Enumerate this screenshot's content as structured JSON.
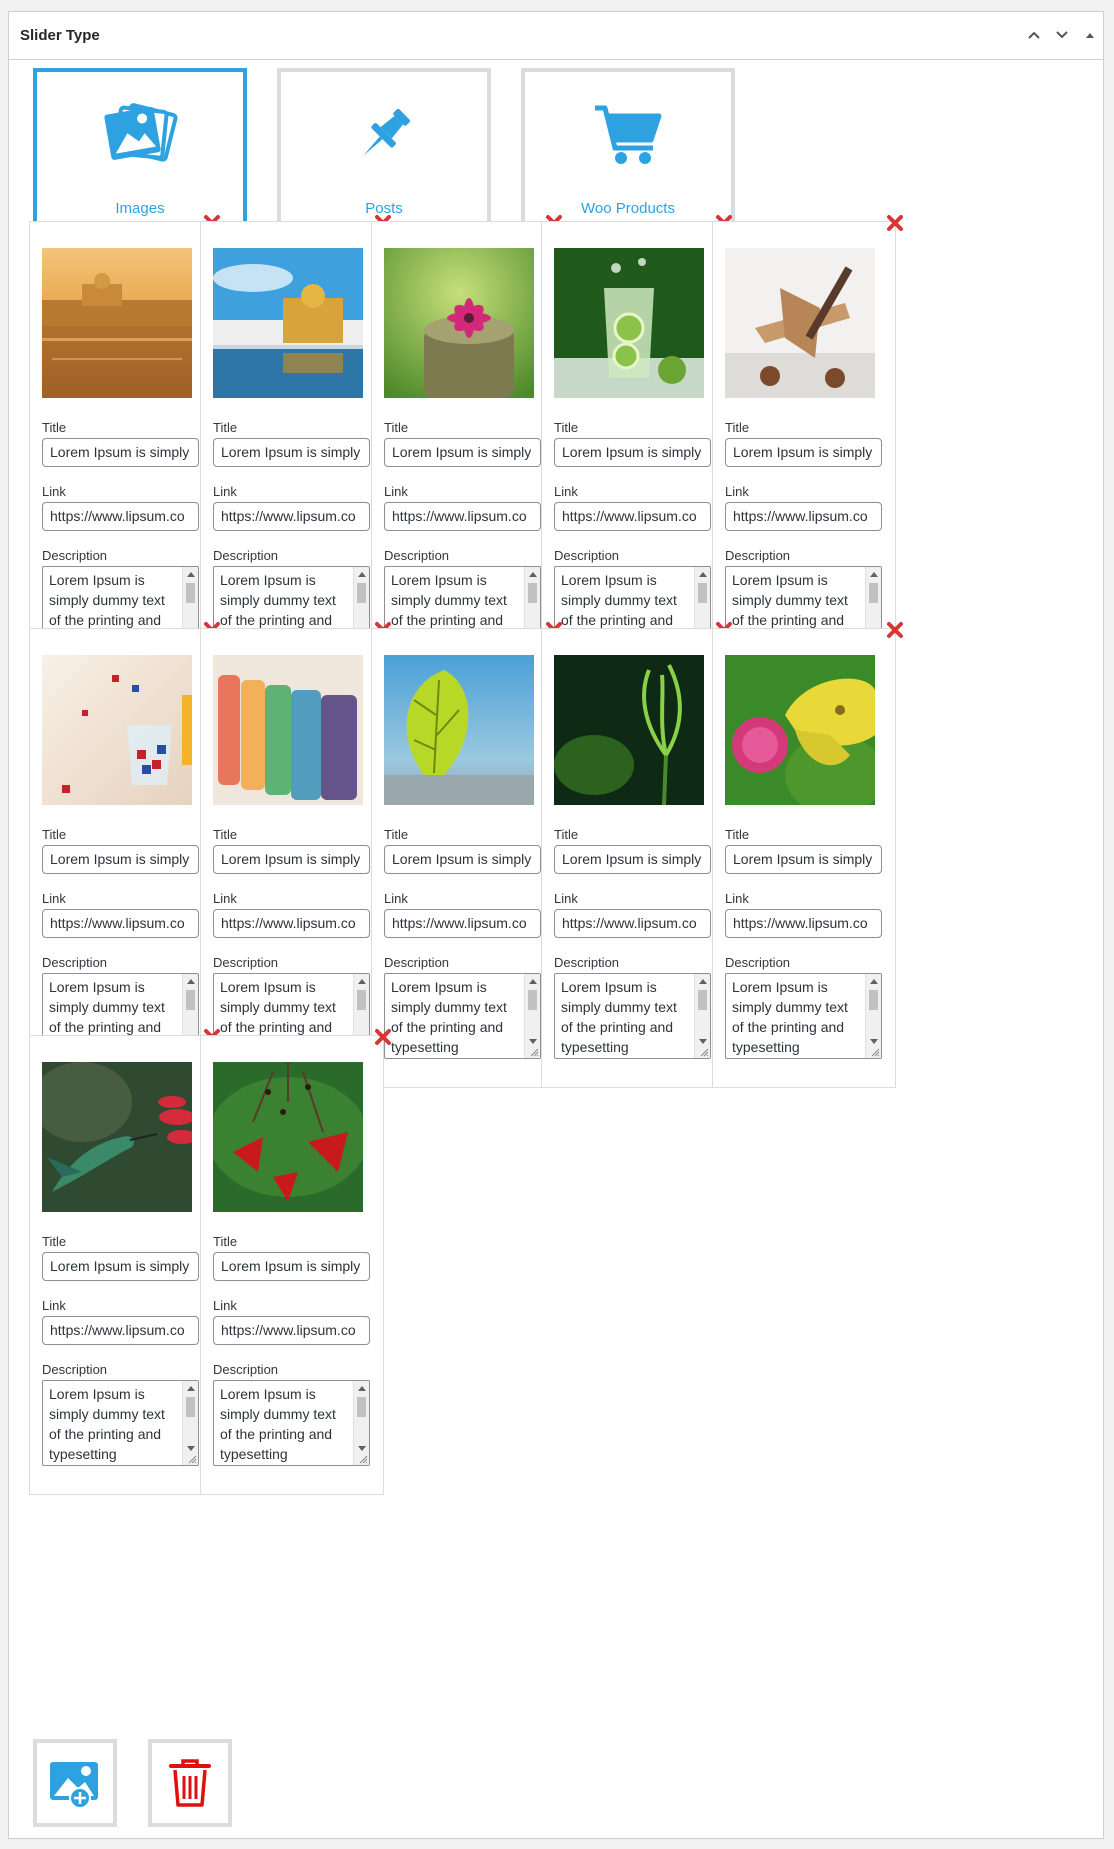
{
  "panel": {
    "title": "Slider Type",
    "header_buttons": [
      "chevron-up-icon",
      "chevron-down-icon",
      "triangle-up-icon"
    ]
  },
  "slider_types": [
    {
      "label": "Images",
      "icon": "images-icon",
      "active": true
    },
    {
      "label": "Posts",
      "icon": "pushpin-icon",
      "active": false
    },
    {
      "label": "Woo Products",
      "icon": "shopping-cart-icon",
      "active": false
    }
  ],
  "field_labels": {
    "title": "Title",
    "link": "Link",
    "description": "Description"
  },
  "slides": [
    {
      "image": "golden-temple-sunset",
      "title": "Lorem Ipsum is simply",
      "link": "https://www.lipsum.co",
      "description": "Lorem Ipsum is simply dummy text of the printing and typesetting"
    },
    {
      "image": "golden-temple-day",
      "title": "Lorem Ipsum is simply",
      "link": "https://www.lipsum.co",
      "description": "Lorem Ipsum is simply dummy text of the printing and typesetting"
    },
    {
      "image": "pink-flower-stump",
      "title": "Lorem Ipsum is simply",
      "link": "https://www.lipsum.co",
      "description": "Lorem Ipsum is simply dummy text of the printing and typesetting"
    },
    {
      "image": "lime-drink-splash",
      "title": "Lorem Ipsum is simply",
      "link": "https://www.lipsum.co",
      "description": "Lorem Ipsum is simply dummy text of the printing and typesetting"
    },
    {
      "image": "wooden-toy-plane",
      "title": "Lorem Ipsum is simply",
      "link": "https://www.lipsum.co",
      "description": "Lorem Ipsum is simply dummy text of the printing and typesetting"
    },
    {
      "image": "dice-in-glass",
      "title": "Lorem Ipsum is simply",
      "link": "https://www.lipsum.co",
      "description": "Lorem Ipsum is simply dummy text of the printing and typesetting"
    },
    {
      "image": "colored-glasses",
      "title": "Lorem Ipsum is simply",
      "link": "https://www.lipsum.co",
      "description": "Lorem Ipsum is simply dummy text of the printing and typesetting"
    },
    {
      "image": "green-leaf-blue-sky",
      "title": "Lorem Ipsum is simply",
      "link": "https://www.lipsum.co",
      "description": "Lorem Ipsum is simply dummy text of the printing and typesetting"
    },
    {
      "image": "green-sprout",
      "title": "Lorem Ipsum is simply",
      "link": "https://www.lipsum.co",
      "description": "Lorem Ipsum is simply dummy text of the printing and typesetting"
    },
    {
      "image": "butterfly-on-clover",
      "title": "Lorem Ipsum is simply",
      "link": "https://www.lipsum.co",
      "description": "Lorem Ipsum is simply dummy text of the printing and typesetting"
    },
    {
      "image": "hummingbird-red-flower",
      "title": "Lorem Ipsum is simply",
      "link": "https://www.lipsum.co",
      "description": "Lorem Ipsum is simply dummy text of the printing and typesetting"
    },
    {
      "image": "red-hanging-flowers",
      "title": "Lorem Ipsum is simply",
      "link": "https://www.lipsum.co",
      "description": "Lorem Ipsum is simply dummy text of the printing and typesetting"
    }
  ],
  "actions": [
    {
      "icon": "add-image-icon"
    },
    {
      "icon": "trash-icon"
    }
  ],
  "colors": {
    "accent": "#2ea2e0",
    "remove": "#d63638",
    "trash": "#e01010",
    "border": "#dcdcdc"
  }
}
